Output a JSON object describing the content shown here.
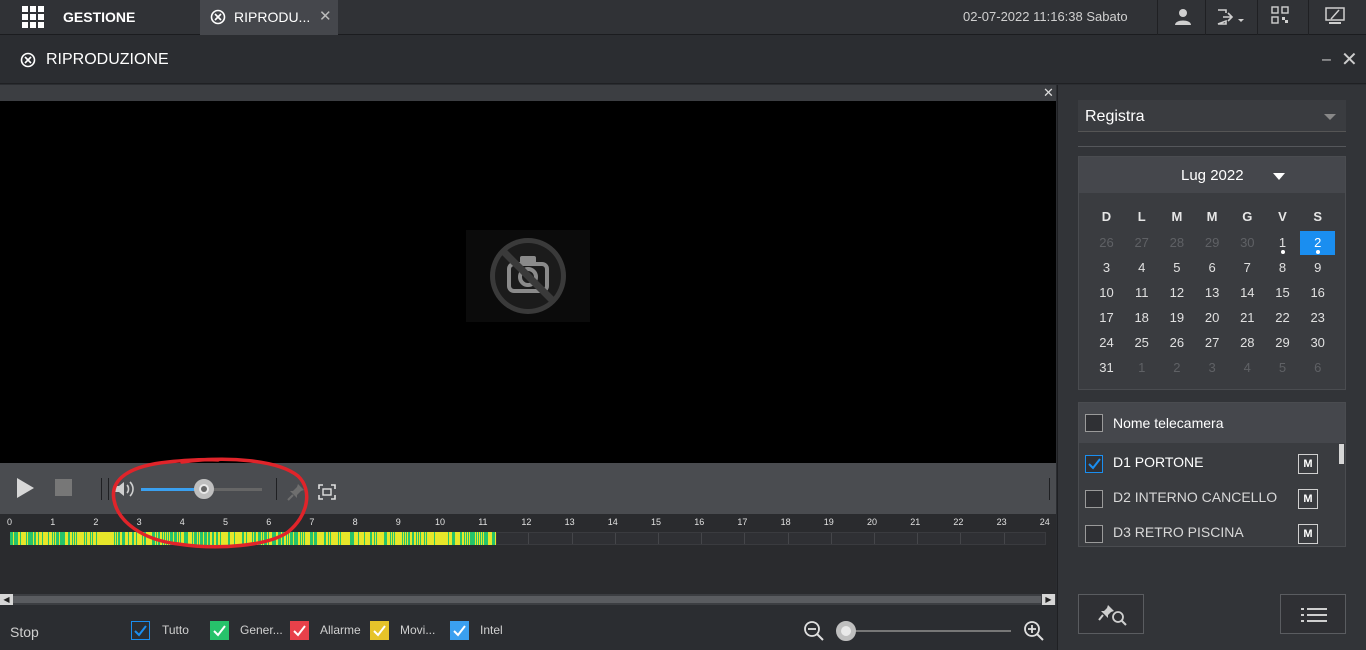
{
  "topbar": {
    "app_title": "GESTIONE",
    "tab_label": "RIPRODU...",
    "tab_close": "✕",
    "datetime": "02-07-2022 11:16:38 Sabato"
  },
  "module": {
    "title": "RIPRODUZIONE",
    "minimize": "–",
    "close": "✕"
  },
  "video": {
    "close": "✕"
  },
  "timeline": {
    "hours": [
      "0",
      "1",
      "2",
      "3",
      "4",
      "5",
      "6",
      "7",
      "8",
      "9",
      "10",
      "11",
      "12",
      "13",
      "14",
      "15",
      "16",
      "17",
      "18",
      "19",
      "20",
      "21",
      "22",
      "23",
      "24"
    ],
    "recorded_until_hour": 11.3
  },
  "scroll": {
    "left": "◀",
    "right": "▶"
  },
  "bottom": {
    "status": "Stop",
    "legend": [
      {
        "label": "Tutto",
        "color": "#1a8ef0"
      },
      {
        "label": "Gener...",
        "color": "#27c26b"
      },
      {
        "label": "Allarme",
        "color": "#e8414a"
      },
      {
        "label": "Movi...",
        "color": "#e6c32a"
      },
      {
        "label": "Intel",
        "color": "#3aa0f0"
      }
    ]
  },
  "right": {
    "record_type": "Registra",
    "calendar": {
      "month": "Lug 2022",
      "weekdays": [
        "D",
        "L",
        "M",
        "M",
        "G",
        "V",
        "S"
      ],
      "weeks": [
        [
          "26",
          "27",
          "28",
          "29",
          "30",
          "1",
          "2"
        ],
        [
          "3",
          "4",
          "5",
          "6",
          "7",
          "8",
          "9"
        ],
        [
          "10",
          "11",
          "12",
          "13",
          "14",
          "15",
          "16"
        ],
        [
          "17",
          "18",
          "19",
          "20",
          "21",
          "22",
          "23"
        ],
        [
          "24",
          "25",
          "26",
          "27",
          "28",
          "29",
          "30"
        ],
        [
          "31",
          "1",
          "2",
          "3",
          "4",
          "5",
          "6"
        ]
      ],
      "selected": "2"
    },
    "cameras": {
      "header": "Nome telecamera",
      "items": [
        {
          "name": "D1 PORTONE",
          "checked": true,
          "badge": "M"
        },
        {
          "name": "D2 INTERNO CANCELLO",
          "checked": false,
          "badge": "M"
        },
        {
          "name": "D3 RETRO PISCINA",
          "checked": false,
          "badge": "M"
        }
      ]
    }
  },
  "colors": {
    "accent": "#1a8ef0",
    "annotation": "#e0242a",
    "record_general": "#27c26b",
    "record_motion": "#e6e62a"
  }
}
